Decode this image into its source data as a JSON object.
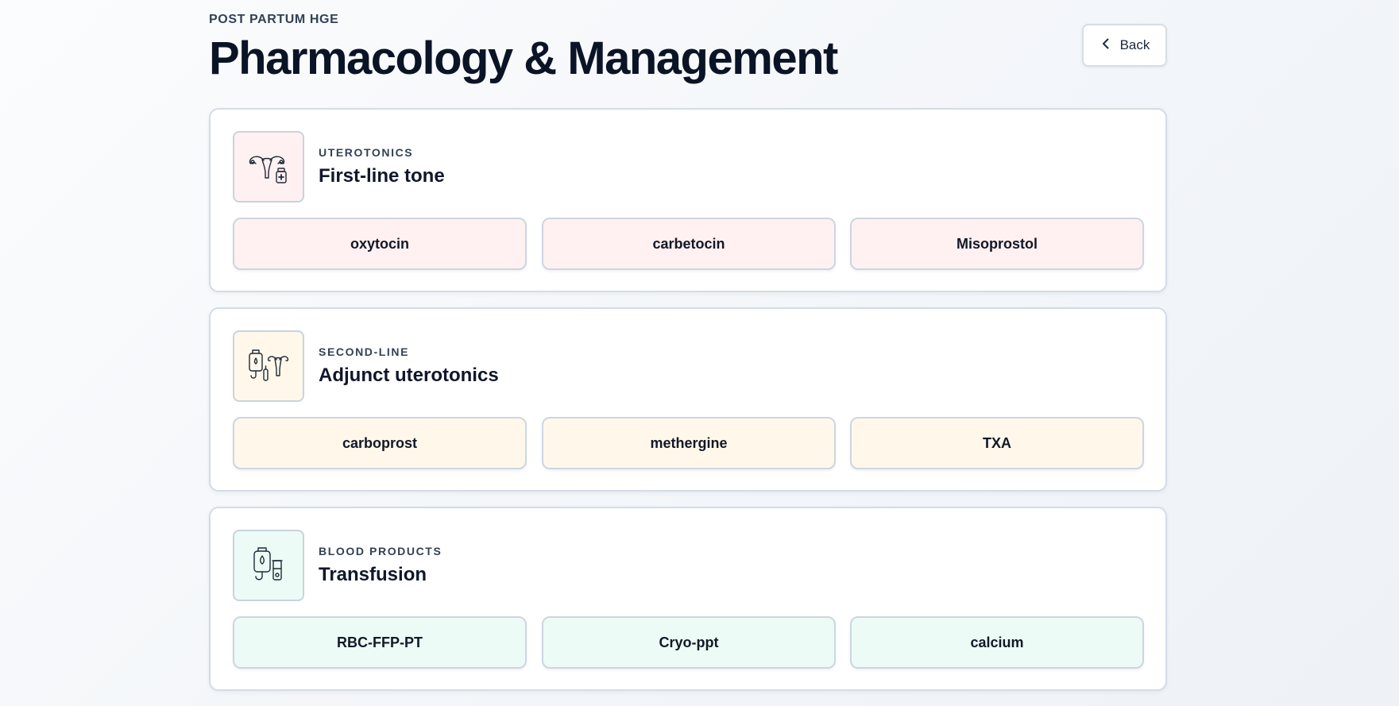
{
  "header": {
    "eyebrow": "POST PARTUM HGE",
    "title": "Pharmacology & Management",
    "back_label": "Back"
  },
  "cards": [
    {
      "eyebrow": "UTEROTONICS",
      "title": "First-line tone",
      "icon": "uterus-medication-icon",
      "accent_bg": "#fff0f1",
      "items": [
        "oxytocin",
        "carbetocin",
        "Misoprostol"
      ]
    },
    {
      "eyebrow": "SECOND-LINE",
      "title": "Adjunct uterotonics",
      "icon": "iv-bag-uterus-icon",
      "accent_bg": "#fff8ea",
      "items": [
        "carboprost",
        "methergine",
        "TXA"
      ]
    },
    {
      "eyebrow": "BLOOD PRODUCTS",
      "title": "Transfusion",
      "icon": "blood-bag-icon",
      "accent_bg": "#ecfbf5",
      "items": [
        "RBC-FFP-PT",
        "Cryo-ppt",
        "calcium"
      ]
    }
  ]
}
